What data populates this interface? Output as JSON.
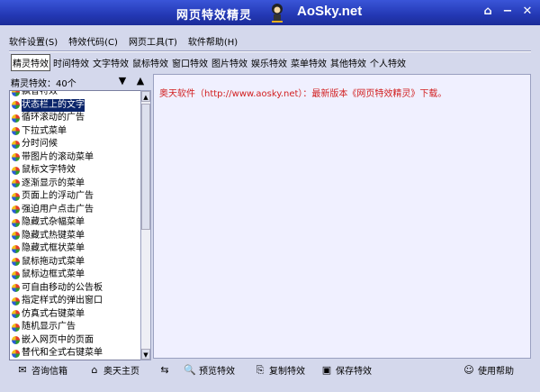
{
  "window": {
    "title": "网页特效精灵",
    "brand": "AoSky.net",
    "buttons": [
      "⌂",
      "−",
      "✕"
    ]
  },
  "menu": [
    "软件设置(S)",
    "特效代码(C)",
    "网页工具(T)",
    "软件帮助(H)"
  ],
  "tabs": [
    "精灵特效",
    "时间特效",
    "文字特效",
    "鼠标特效",
    "窗口特效",
    "图片特效",
    "娱乐特效",
    "菜单特效",
    "其他特效",
    "个人特效"
  ],
  "active_tab": 0,
  "left_panel": {
    "count_label": "精灵特效：40个",
    "items": [
      "飘香特效",
      "状态栏上的文字",
      "循环滚动的广告",
      "下拉式菜单",
      "分时问候",
      "带图片的滚动菜单",
      "鼠标文字特效",
      "逐渐显示的菜单",
      "页面上的浮动广告",
      "强迫用户点击广告",
      "隐藏式杂幅菜单",
      "隐藏式热键菜单",
      "隐藏式框状菜单",
      "鼠标拖动式菜单",
      "鼠标边框式菜单",
      "可自由移动的公告板",
      "指定样式的弹出窗口",
      "仿真式右键菜单",
      "随机显示广告",
      "嵌入网页中的页面",
      "替代和全式右键菜单"
    ],
    "selected_index": 1
  },
  "content": {
    "message": "奥天软件（http://www.aosky.net）：最新版本《网页特效精灵》下载。"
  },
  "bottom": {
    "mail": "咨询信箱",
    "home": "奥天主页",
    "preview": "预览特效",
    "copy": "复制特效",
    "save": "保存特效",
    "help": "使用帮助"
  },
  "colors": {
    "titlebar": "#2338B4",
    "background": "#D4D8EC",
    "content_bg": "#F0F0FF",
    "message_text": "#D22020",
    "selection": "#0A246A"
  }
}
